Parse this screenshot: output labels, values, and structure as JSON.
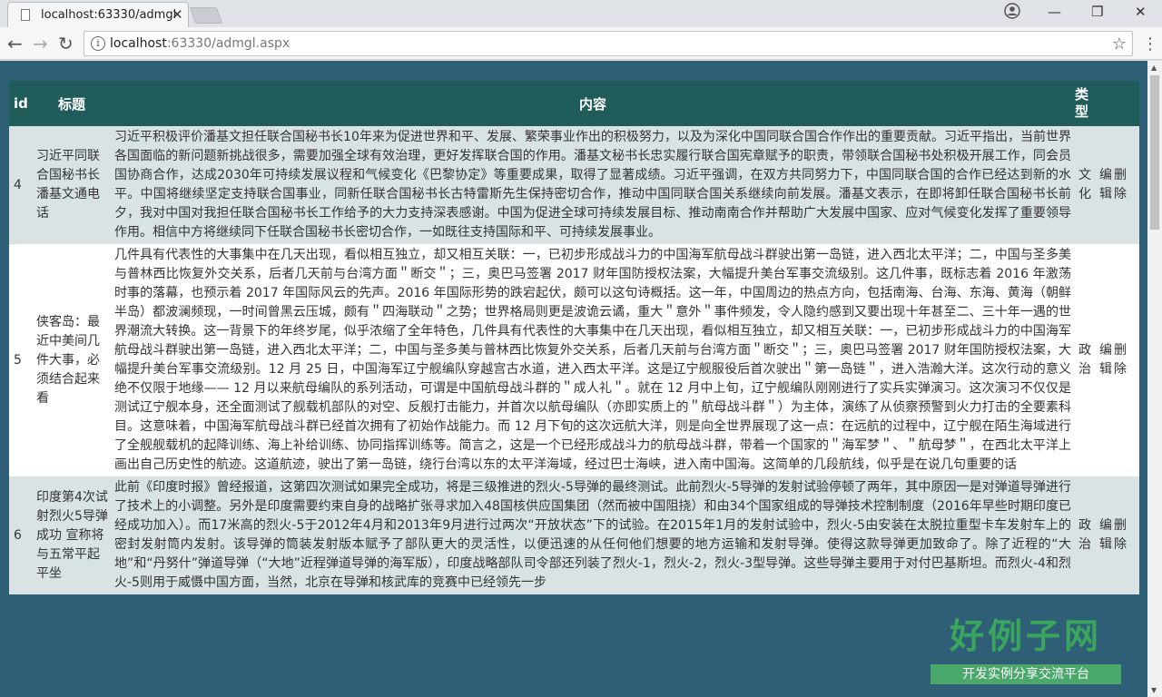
{
  "browser": {
    "tab_title": "localhost:63330/admgl",
    "url_host": "localhost",
    "url_rest": ":63330/admgl.aspx"
  },
  "table": {
    "headers": {
      "id": "id",
      "title": "标题",
      "content": "内容",
      "type": "类型"
    },
    "rows": [
      {
        "id": "4",
        "title": "习近平同联合国秘书长潘基文通电话",
        "content": "习近平积极评价潘基文担任联合国秘书长10年来为促进世界和平、发展、繁荣事业作出的积极努力，以及为深化中国同联合国合作作出的重要贡献。习近平指出，当前世界各国面临的新问题新挑战很多，需要加强全球有效治理，更好发挥联合国的作用。潘基文秘书长忠实履行联合国宪章赋予的职责，带领联合国秘书处积极开展工作，同会员国协商合作，达成2030年可持续发展议程和气候变化《巴黎协定》等重要成果，取得了显著成绩。习近平强调，在双方共同努力下，中国同联合国的合作已经达到新的水平。中国将继续坚定支持联合国事业，同新任联合国秘书长古特雷斯先生保持密切合作，推动中国同联合国关系继续向前发展。潘基文表示，在即将卸任联合国秘书长前夕，我对中国对我担任联合国秘书长工作给予的大力支持深表感谢。中国为促进全球可持续发展目标、推动南南合作并帮助广大发展中国家、应对气候变化发挥了重要领导作用。相信中方将继续同下任联合国秘书长密切合作，一如既往支持国际和平、可持续发展事业。",
        "type": "文化",
        "edit": "编辑",
        "delete": "删除"
      },
      {
        "id": "5",
        "title": "侠客岛：最近中美间几件大事，必须结合起来看",
        "content": "几件具有代表性的大事集中在几天出现，看似相互独立，却又相互关联：一，已初步形成战斗力的中国海军航母战斗群驶出第一岛链，进入西北太平洋；二，中国与圣多美与普林西比恢复外交关系，后者几天前与台湾方面＂断交＂；三，奥巴马签署 2017 财年国防授权法案，大幅提升美台军事交流级别。这几件事，既标志着 2016 年激荡时事的落幕，也预示着 2017 年国际风云的先声。2016 年国际形势的跌宕起伏，颇可以这句诗概括。这一年，中国周边的热点方向，包括南海、台海、东海、黄海（朝鲜半岛）都波澜频现，一时间曾黑云压城，颇有＂四海联动＂之势；世界格局则更是波诡云谲，重大＂意外＂事件频发，令人隐约感到又要出现十年甚至二、三十年一遇的世界潮流大转换。这一背景下的年终岁尾，似乎浓缩了全年特色，几件具有代表性的大事集中在几天出现，看似相互独立，却又相互关联：一，已初步形成战斗力的中国海军航母战斗群驶出第一岛链，进入西北太平洋；二，中国与圣多美与普林西比恢复外交关系，后者几天前与台湾方面＂断交＂；三，奥巴马签署 2017 财年国防授权法案，大幅提升美台军事交流级别。12 月 25 日，中国海军辽宁舰编队穿越宫古水道，进入西太平洋。这是辽宁舰服役后首次驶出＂第一岛链＂，进入浩瀚大洋。这次行动的意义绝不仅限于地缘—— 12 月以来航母编队的系列活动，可谓是中国航母战斗群的＂成人礼＂。就在 12 月中上旬，辽宁舰编队刚刚进行了实兵实弹演习。这次演习不仅仅是测试辽宁舰本身，还全面测试了舰载机部队的对空、反舰打击能力，并首次以航母编队（亦即实质上的＂航母战斗群＂）为主体，演练了从侦察预警到火力打击的全要素科目。这意味着，中国海军航母战斗群已经首次拥有了初始作战能力。而 12 月下旬的这次远航大洋，则是向全世界展现了这一点：在远航的过程中，辽宁舰在陌生海域进行了全舰舰载机的起降训练、海上补给训练、协同指挥训练等。简言之，这是一个已经形成战斗力的航母战斗群，带着一个国家的＂海军梦＂、＂航母梦＂，在西北太平洋上画出自己历史性的航迹。这道航迹，驶出了第一岛链，绕行台湾以东的太平洋海域，经过巴士海峡，进入南中国海。这简单的几段航线，似乎是在说几句重要的话",
        "type": "政治",
        "edit": "编辑",
        "delete": "删除"
      },
      {
        "id": "6",
        "title": "印度第4次试射烈火5导弹成功 宣称将与五常平起平坐",
        "content": "此前《印度时报》曾经报道，这第四次测试如果完全成功，将是三级推进的烈火-5导弹的最终测试。此前烈火-5导弹的发射试验停顿了两年，其中原因一是对弹道导弹进行了技术上的小调整。另外是印度需要约束自身的战略扩张寻求加入48国核供应国集团（然而被中国阻挠）和由34个国家组成的导弹技术控制制度（2016年早些时期印度已经成功加入）。而17米高的烈火-5于2012年4月和2013年9月进行过两次“开放状态”下的试验。在2015年1月的发射试验中，烈火-5由安装在太脱拉重型卡车发射车上的密封发射筒内发射。该导弹的筒装发射版本赋予了部队更大的灵活性，以便迅速的从任何他们想要的地方运输和发射导弹。使得这款导弹更加致命了。除了近程的“大地”和“丹努什”弹道导弹（“大地”近程弹道导弹的海军版），印度战略部队司令部还列装了烈火-1，烈火-2，烈火-3型导弹。这些导弹主要用于对付巴基斯坦。而烈火-4和烈火-5则用于威慑中国方面，当然，北京在导弹和核武库的竞赛中已经领先一步",
        "type": "政治",
        "edit": "编辑",
        "delete": "删除"
      }
    ]
  },
  "watermark": {
    "logo_text": "好例子网",
    "tagline": "开发实例分享交流平台"
  },
  "colors": {
    "header_bg": "#1f5c5a",
    "page_bg": "#2f5f77",
    "row_alt": "#d9e3e4"
  }
}
